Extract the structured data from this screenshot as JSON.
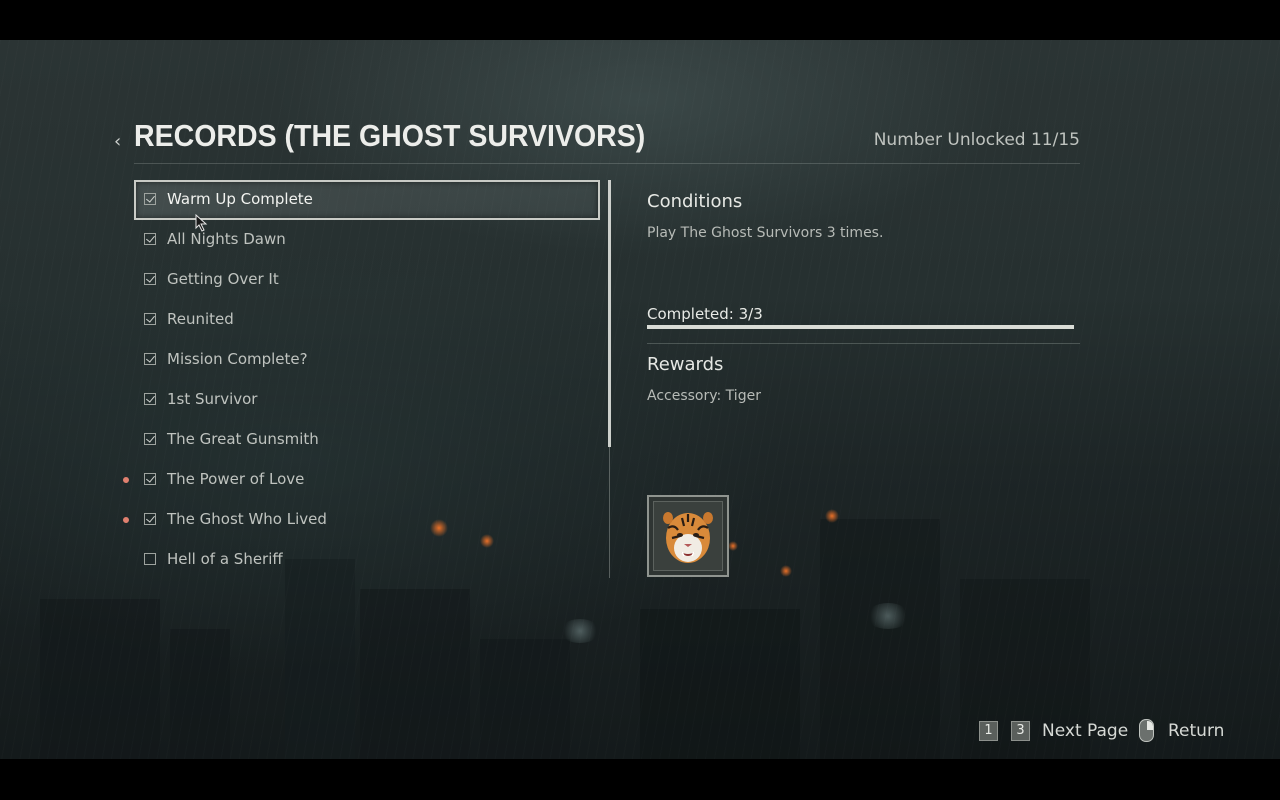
{
  "header": {
    "back_glyph": "‹",
    "title": "RECORDS (THE GHOST SURVIVORS)",
    "unlocked": "Number Unlocked 11/15"
  },
  "records": [
    {
      "label": "Warm Up Complete",
      "checked": true,
      "is_new": false,
      "selected": true
    },
    {
      "label": "All Nights Dawn",
      "checked": true,
      "is_new": false,
      "selected": false
    },
    {
      "label": "Getting Over It",
      "checked": true,
      "is_new": false,
      "selected": false
    },
    {
      "label": "Reunited",
      "checked": true,
      "is_new": false,
      "selected": false
    },
    {
      "label": "Mission Complete?",
      "checked": true,
      "is_new": false,
      "selected": false
    },
    {
      "label": "1st Survivor",
      "checked": true,
      "is_new": false,
      "selected": false
    },
    {
      "label": "The Great Gunsmith",
      "checked": true,
      "is_new": false,
      "selected": false
    },
    {
      "label": "The Power of Love",
      "checked": true,
      "is_new": true,
      "selected": false
    },
    {
      "label": "The Ghost Who Lived",
      "checked": true,
      "is_new": true,
      "selected": false
    },
    {
      "label": "Hell of a Sheriff",
      "checked": false,
      "is_new": false,
      "selected": false
    }
  ],
  "details": {
    "conditions_heading": "Conditions",
    "conditions_text": "Play The Ghost Survivors 3 times.",
    "progress_label": "Completed: 3/3",
    "progress_fraction": 1.0,
    "rewards_heading": "Rewards",
    "reward_text": "Accessory: Tiger",
    "reward_icon": "tiger-mask-icon"
  },
  "footer": {
    "key_prev": "1",
    "key_next": "3",
    "next_page_label": "Next Page",
    "return_label": "Return",
    "mouse_icon": "mouse-right-button-icon"
  },
  "colors": {
    "new_indicator": "#e0806f",
    "selection_border": "#c9cbc6"
  }
}
